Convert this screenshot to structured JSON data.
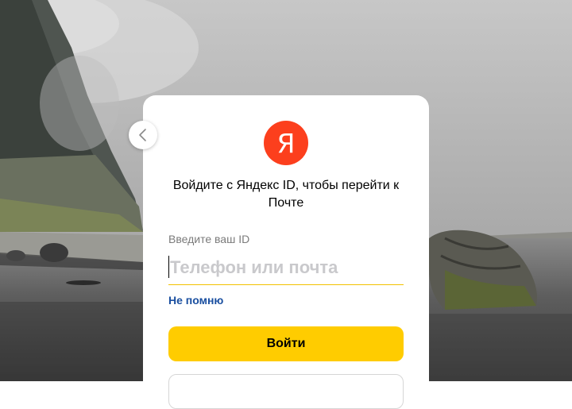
{
  "logo": {
    "letter": "Я"
  },
  "title": "Войдите с Яндекс ID, чтобы перейти к Почте",
  "login_field": {
    "label": "Введите ваш ID",
    "placeholder": "Телефон или почта",
    "value": ""
  },
  "forgot_link": "Не помню",
  "login_button": "Войти",
  "colors": {
    "brand_red": "#fc3f1d",
    "button_yellow": "#ffcc00",
    "link_blue": "#1a4fa0"
  },
  "icons": {
    "back": "chevron-left-icon"
  }
}
